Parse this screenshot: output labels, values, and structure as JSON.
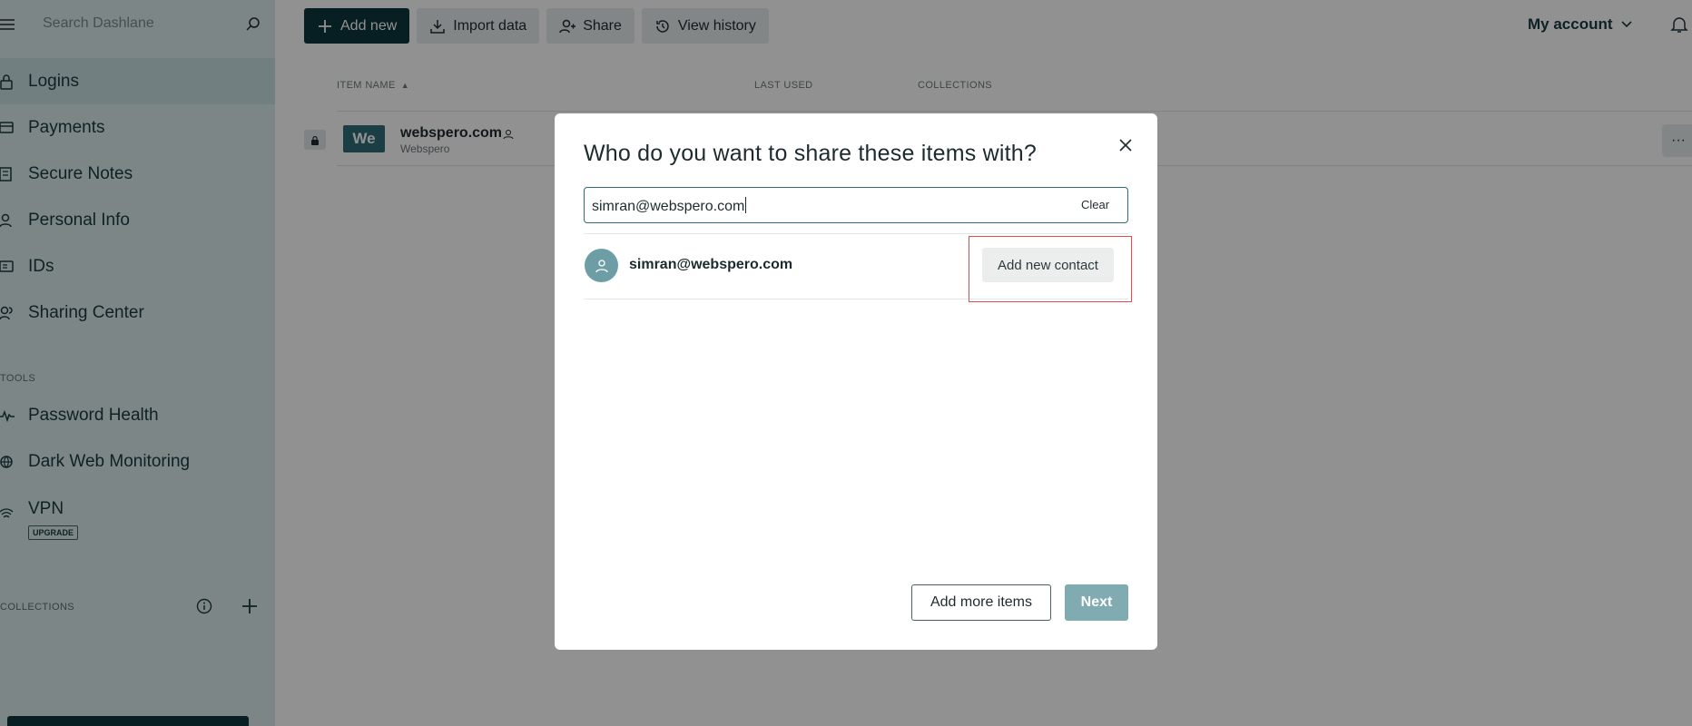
{
  "sidebar": {
    "search_placeholder": "Search Dashlane",
    "nav_items": [
      {
        "label": "Logins",
        "icon": "lock-icon"
      },
      {
        "label": "Payments",
        "icon": "card-icon"
      },
      {
        "label": "Secure Notes",
        "icon": "note-icon"
      },
      {
        "label": "Personal Info",
        "icon": "person-icon"
      },
      {
        "label": "IDs",
        "icon": "id-icon"
      },
      {
        "label": "Sharing Center",
        "icon": "sharing-icon"
      }
    ],
    "tools_label": "TOOLS",
    "tools_items": [
      {
        "label": "Password Health",
        "icon": "pulse-icon"
      },
      {
        "label": "Dark Web Monitoring",
        "icon": "web-icon"
      },
      {
        "label": "VPN",
        "icon": "wifi-icon",
        "badge": "UPGRADE"
      }
    ],
    "collections_label": "COLLECTIONS"
  },
  "toolbar": {
    "add_new": "Add new",
    "import_data": "Import data",
    "share": "Share",
    "view_history": "View history",
    "account": "My account"
  },
  "table": {
    "columns": [
      "ITEM NAME",
      "LAST USED",
      "COLLECTIONS"
    ],
    "rows": [
      {
        "logo": "We",
        "title": "webspero.com",
        "subtitle": "Webspero",
        "more": "···"
      }
    ]
  },
  "modal": {
    "title": "Who do you want to share these items with?",
    "input_value": "simran@webspero.com",
    "clear_label": "Clear",
    "result_email": "simran@webspero.com",
    "add_contact_label": "Add new contact",
    "add_more_label": "Add more items",
    "next_label": "Next"
  },
  "colors": {
    "sidebar_bg": "#dcebed",
    "brand_dark": "#0e353d",
    "accent": "#2f6e78",
    "next_disabled": "#7fabb1",
    "highlight": "#e5484d"
  }
}
